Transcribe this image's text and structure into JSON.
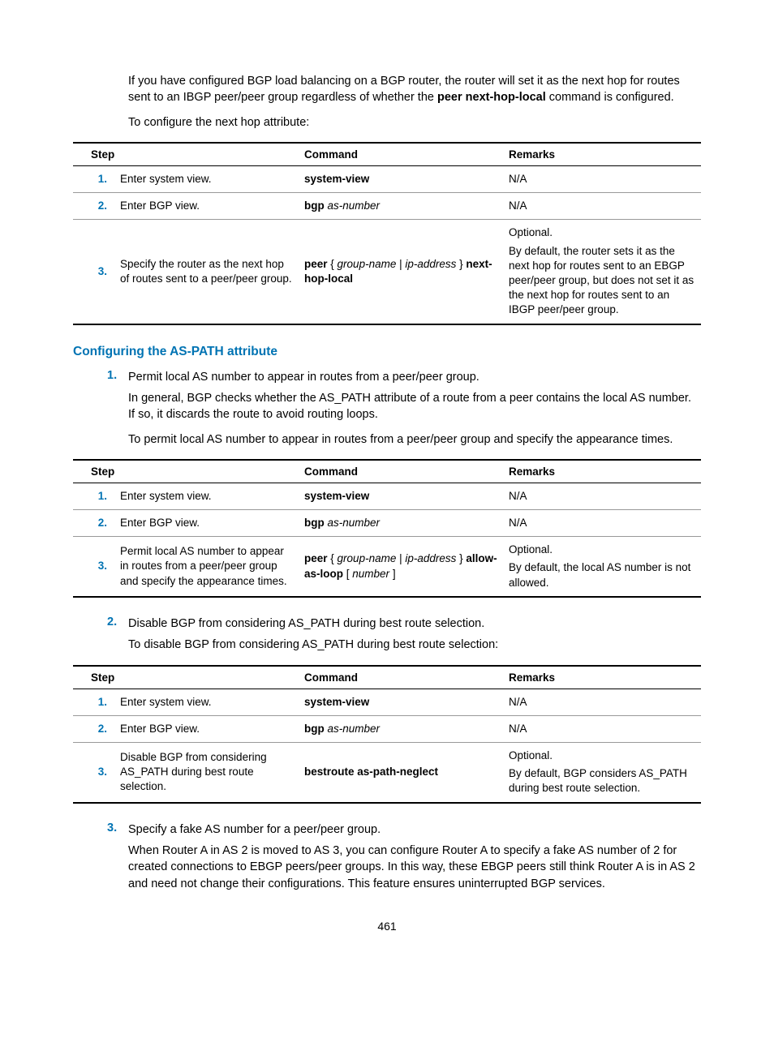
{
  "intro1_before": "If you have configured BGP load balancing on a BGP router, the router will set it as the next hop for routes sent to an IBGP peer/peer group regardless of whether the ",
  "intro1_cmd": "peer next-hop-local",
  "intro1_after": " command is configured.",
  "intro2": "To configure the next hop attribute:",
  "table_headers": {
    "step": "Step",
    "command": "Command",
    "remarks": "Remarks"
  },
  "table1": [
    {
      "n": "1.",
      "step": "Enter system view.",
      "cmd": "<span class='b'>system-view</span>",
      "remarks": "N/A"
    },
    {
      "n": "2.",
      "step": "Enter BGP view.",
      "cmd": "<span class='b'>bgp</span> <span class='italic'>as-number</span>",
      "remarks": "N/A"
    },
    {
      "n": "3.",
      "step": "Specify the router as the next hop of routes sent to a peer/peer group.",
      "cmd": "<span class='b'>peer</span> { <span class='italic'>group-name</span> | <span class='italic'>ip-address</span> } <span class='b'>next-hop-local</span>",
      "remarks": "<p>Optional.</p><p>By default, the router sets it as the next hop for routes sent to an EBGP peer/peer group, but does not set it as the next hop for routes sent to an IBGP peer/peer group.</p>"
    }
  ],
  "sec_heading": "Configuring the AS-PATH attribute",
  "ol1": {
    "num": "1.",
    "line1": "Permit local AS number to appear in routes from a peer/peer group.",
    "para1": "In general, BGP checks whether the AS_PATH attribute of a route from a peer contains the local AS number. If so, it discards the route to avoid routing loops.",
    "para2": "To permit local AS number to appear in routes from a peer/peer group and specify the appearance times."
  },
  "table2": [
    {
      "n": "1.",
      "step": "Enter system view.",
      "cmd": "<span class='b'>system-view</span>",
      "remarks": "N/A"
    },
    {
      "n": "2.",
      "step": "Enter BGP view.",
      "cmd": "<span class='b'>bgp</span> <span class='italic'>as-number</span>",
      "remarks": "N/A"
    },
    {
      "n": "3.",
      "step": "Permit local AS number to appear in routes from a peer/peer group and specify the appearance times.",
      "cmd": "<span class='b'>peer</span> { <span class='italic'>group-name</span> | <span class='italic'>ip-address</span> } <span class='b'>allow-as-loop</span> [ <span class='italic'>number</span> ]",
      "remarks": "<p>Optional.</p><p>By default, the local AS number is not allowed.</p>"
    }
  ],
  "ol2": {
    "num": "2.",
    "line1": "Disable BGP from considering AS_PATH during best route selection.",
    "para1": "To disable BGP from considering AS_PATH during best route selection:"
  },
  "table3": [
    {
      "n": "1.",
      "step": "Enter system view.",
      "cmd": "<span class='b'>system-view</span>",
      "remarks": "N/A"
    },
    {
      "n": "2.",
      "step": "Enter BGP view.",
      "cmd": "<span class='b'>bgp</span> <span class='italic'>as-number</span>",
      "remarks": "N/A"
    },
    {
      "n": "3.",
      "step": "Disable BGP from considering AS_PATH during best route selection.",
      "cmd": "<span class='b'>bestroute as-path-neglect</span>",
      "remarks": "<p>Optional.</p><p>By default, BGP considers AS_PATH during best route selection.</p>"
    }
  ],
  "ol3": {
    "num": "3.",
    "line1": "Specify a fake AS number for a peer/peer group.",
    "para1": "When Router A in AS 2 is moved to AS 3, you can configure Router A to specify a fake AS number of 2 for created connections to EBGP peers/peer groups. In this way, these EBGP peers still think Router A is in AS 2 and need not change their configurations. This feature ensures uninterrupted BGP services."
  },
  "page_number": "461"
}
